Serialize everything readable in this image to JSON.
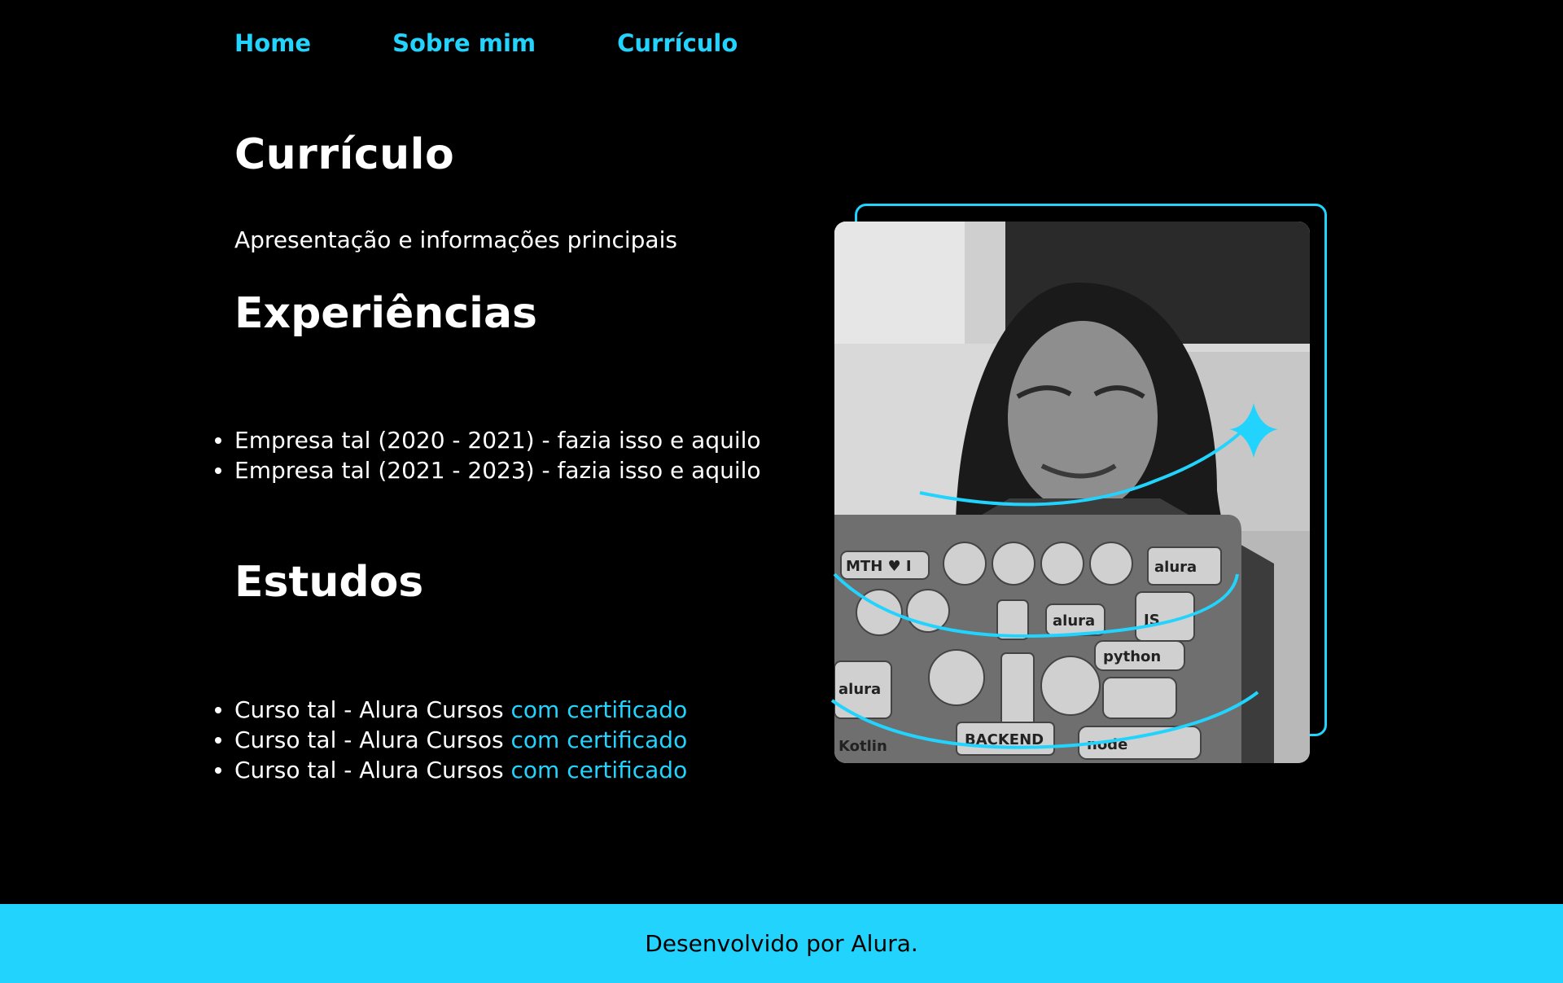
{
  "nav": {
    "items": [
      {
        "label": "Home"
      },
      {
        "label": "Sobre mim"
      },
      {
        "label": "Currículo"
      }
    ]
  },
  "main": {
    "title": "Currículo",
    "subtitle": "Apresentação e informações principais",
    "experiencias": {
      "heading": "Experiências",
      "items": [
        "Empresa tal (2020 - 2021) - fazia isso e aquilo",
        "Empresa tal (2021 - 2023) - fazia isso e aquilo"
      ]
    },
    "estudos": {
      "heading": "Estudos",
      "items": [
        {
          "text": "Curso tal - Alura Cursos ",
          "link": "com certificado"
        },
        {
          "text": "Curso tal - Alura Cursos ",
          "link": "com certificado"
        },
        {
          "text": "Curso tal - Alura Cursos ",
          "link": "com certificado"
        }
      ]
    }
  },
  "image": {
    "stickers": [
      "MTH ♥ I",
      "alura",
      "JS",
      "alura",
      "python",
      "alura",
      "BACKEND",
      "node",
      "Kotlin"
    ]
  },
  "footer": {
    "text": "Desenvolvido por Alura."
  },
  "colors": {
    "accent": "#22d4fd",
    "background": "#000000",
    "text": "#ffffff"
  }
}
